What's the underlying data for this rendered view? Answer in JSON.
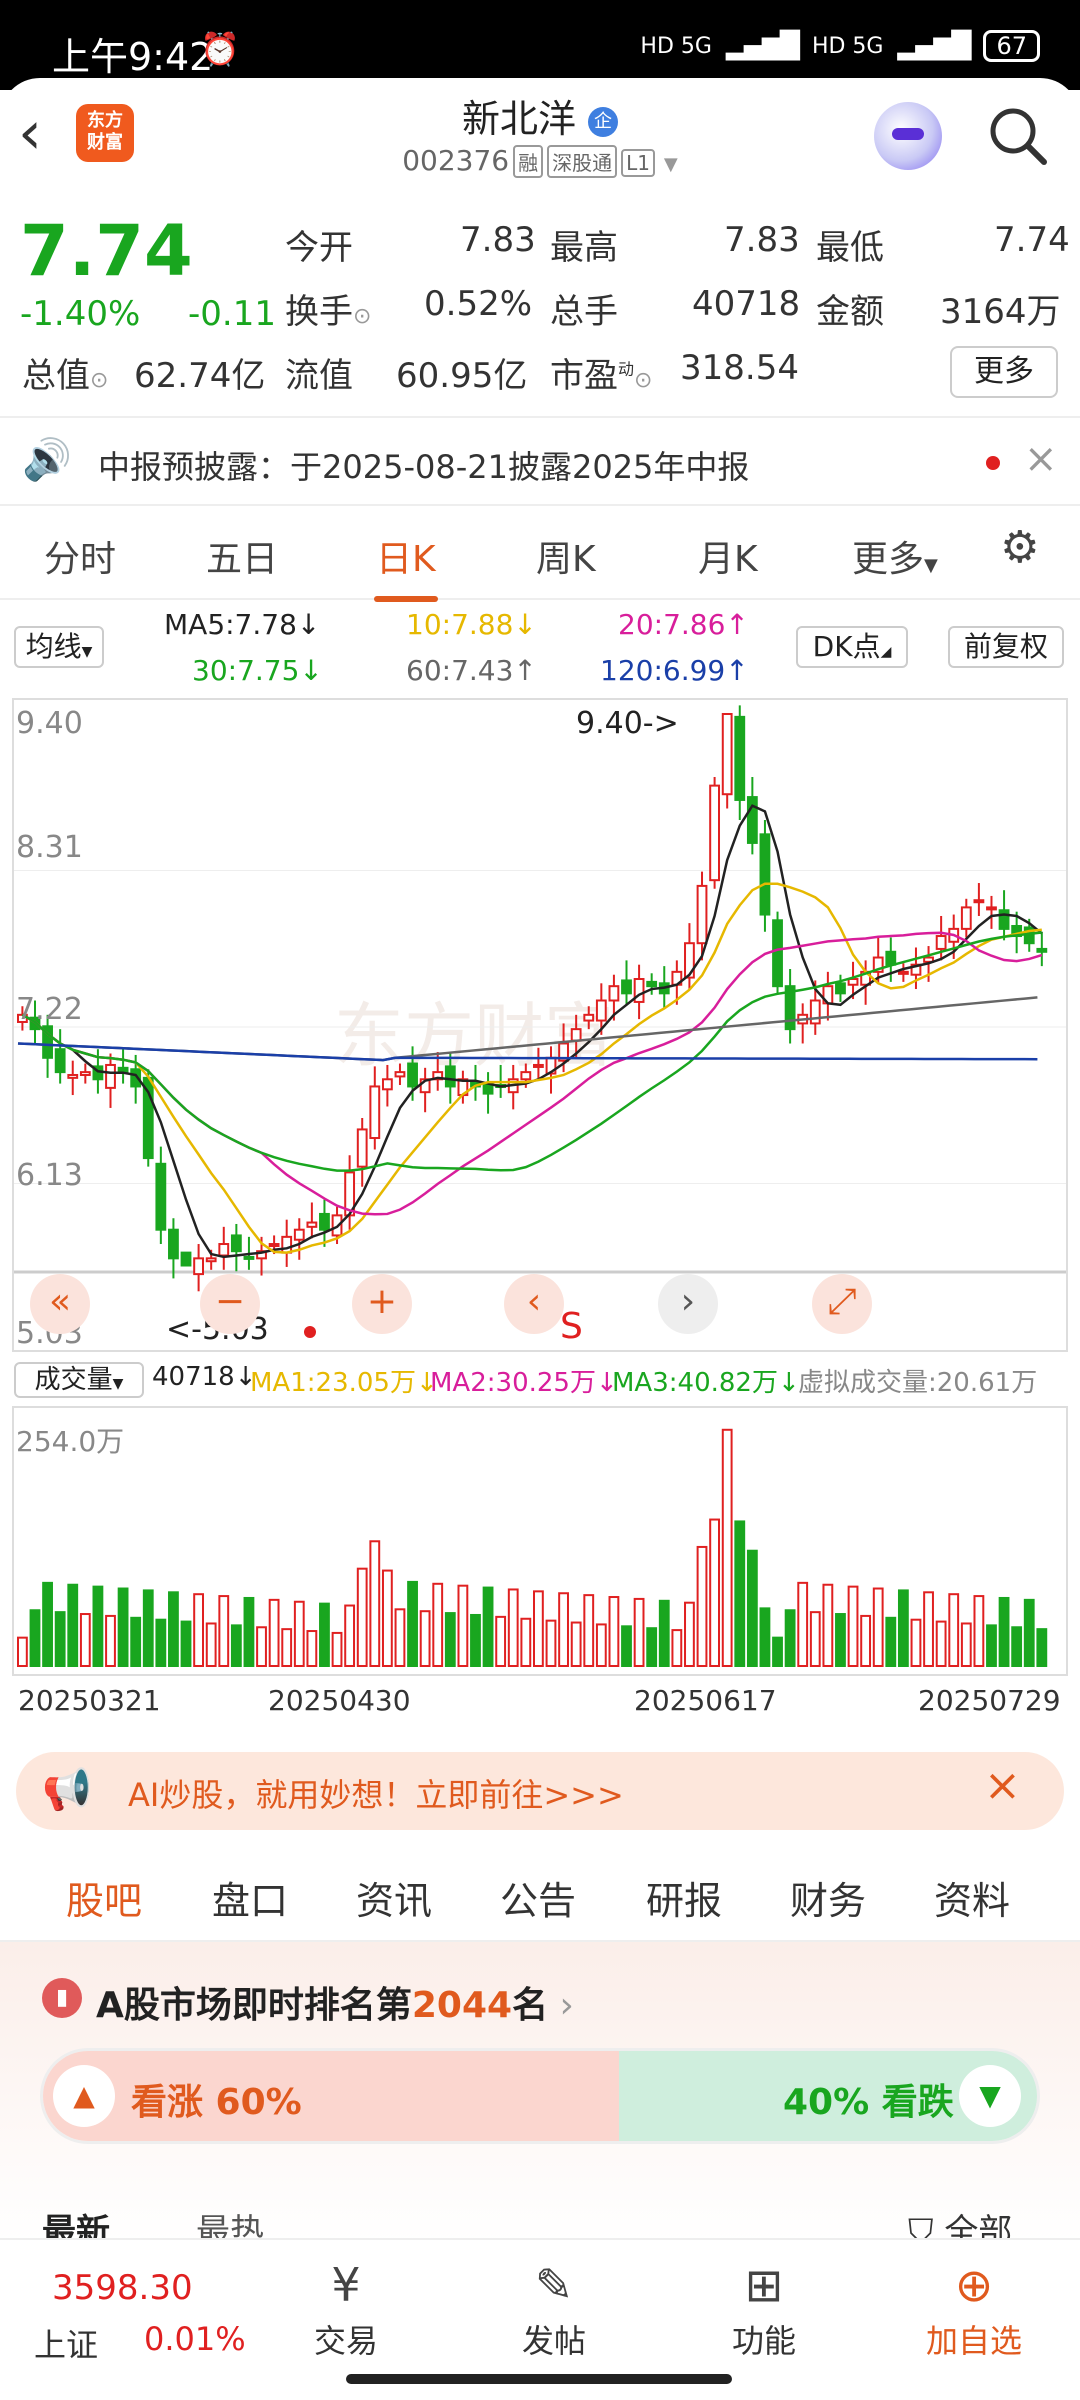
{
  "status_bar": {
    "time": "上午9:42",
    "alarm_icon": "alarm-icon",
    "signal_left": "HD 5G",
    "signal_right": "HD 5G",
    "battery": "67"
  },
  "header": {
    "logo_text": "东方\n财富",
    "name": "新北洋",
    "name_badge": "企",
    "code": "002376",
    "tags": [
      "融",
      "深股通",
      "L1"
    ]
  },
  "quote": {
    "price": "7.74",
    "change_pct": "-1.40%",
    "change": "-0.11",
    "fields": [
      {
        "label": "今开",
        "value": "7.83"
      },
      {
        "label": "最高",
        "value": "7.83"
      },
      {
        "label": "最低",
        "value": "7.74"
      },
      {
        "label": "换手",
        "value": "0.52%"
      },
      {
        "label": "总手",
        "value": "40718"
      },
      {
        "label": "金额",
        "value": "3164万"
      },
      {
        "label": "总值",
        "value": "62.74亿"
      },
      {
        "label": "流值",
        "value": "60.95亿"
      },
      {
        "label": "市盈",
        "value": "318.54"
      }
    ],
    "pe_sup": "动",
    "more": "更多"
  },
  "notice": {
    "text": "中报预披露：于2025-08-21披露2025年中报"
  },
  "chart_tabs": {
    "items": [
      "分时",
      "五日",
      "日K",
      "周K",
      "月K",
      "更多"
    ],
    "active": "日K"
  },
  "ma": {
    "selector": "均线",
    "ma5": "MA5:7.78",
    "ma10": "10:7.88",
    "ma20": "20:7.86",
    "ma30": "30:7.75",
    "ma60": "60:7.43",
    "ma120": "120:6.99",
    "dk": "DK点",
    "adjust": "前复权",
    "colors": {
      "ma5": "#222222",
      "ma10": "#e6b800",
      "ma20": "#d81e9b",
      "ma30": "#19a61f",
      "ma60": "#666666",
      "ma120": "#1a3fa8"
    }
  },
  "kline": {
    "y_labels": [
      "9.40",
      "8.31",
      "7.22",
      "6.13",
      "5.03"
    ],
    "high_mark": "9.40->",
    "low_mark": "<-5.03",
    "s_mark": "S",
    "watermark": "东方财富"
  },
  "volume": {
    "selector": "成交量",
    "vol": "40718",
    "ma1": "MA1:23.05万",
    "ma2": "MA2:30.25万",
    "ma3": "MA3:40.82万",
    "virtual": "虚拟成交量:20.61万",
    "ymax": "254.0万",
    "dates": [
      "20250321",
      "20250430",
      "20250617",
      "20250729"
    ]
  },
  "chart_data": {
    "type": "candlestick",
    "ylim": [
      5.03,
      9.4
    ],
    "high": 9.4,
    "low": 5.03,
    "closes": [
      7.3,
      7.2,
      7.0,
      6.9,
      6.88,
      6.9,
      6.85,
      6.95,
      6.9,
      6.8,
      6.3,
      5.8,
      5.6,
      5.55,
      5.6,
      5.6,
      5.7,
      5.65,
      5.6,
      5.65,
      5.7,
      5.75,
      5.8,
      5.85,
      5.8,
      5.9,
      6.2,
      6.5,
      6.8,
      6.85,
      6.9,
      6.8,
      6.85,
      6.9,
      6.8,
      6.85,
      6.8,
      6.75,
      6.8,
      6.85,
      6.9,
      6.95,
      7.0,
      7.1,
      7.2,
      7.3,
      7.4,
      7.5,
      7.45,
      7.55,
      7.5,
      7.45,
      7.6,
      7.8,
      8.2,
      8.9,
      9.4,
      8.8,
      8.5,
      8.0,
      7.5,
      7.2,
      7.3,
      7.4,
      7.5,
      7.45,
      7.55,
      7.6,
      7.7,
      7.65,
      7.6,
      7.65,
      7.7,
      7.85,
      7.9,
      8.05,
      8.1,
      8.05,
      7.9,
      7.85,
      7.8,
      7.74
    ]
  },
  "banner": {
    "text": "AI炒股，就用妙想！立即前往>>>"
  },
  "info_tabs": {
    "items": [
      "股吧",
      "盘口",
      "资讯",
      "公告",
      "研报",
      "财务",
      "资料"
    ],
    "active": "股吧"
  },
  "rank": {
    "prefix": "A股市场即时排名第",
    "number": "2044",
    "suffix": "名",
    "up_label": "看涨 60%",
    "down_label": "40% 看跌",
    "partial_left": "最新",
    "partial_mid": "最热",
    "partial_right": "全部"
  },
  "bottom_nav": {
    "index_value": "3598.30",
    "index_name": "上证",
    "index_change": "0.01%",
    "items": [
      "交易",
      "发帖",
      "功能",
      "加自选"
    ]
  }
}
